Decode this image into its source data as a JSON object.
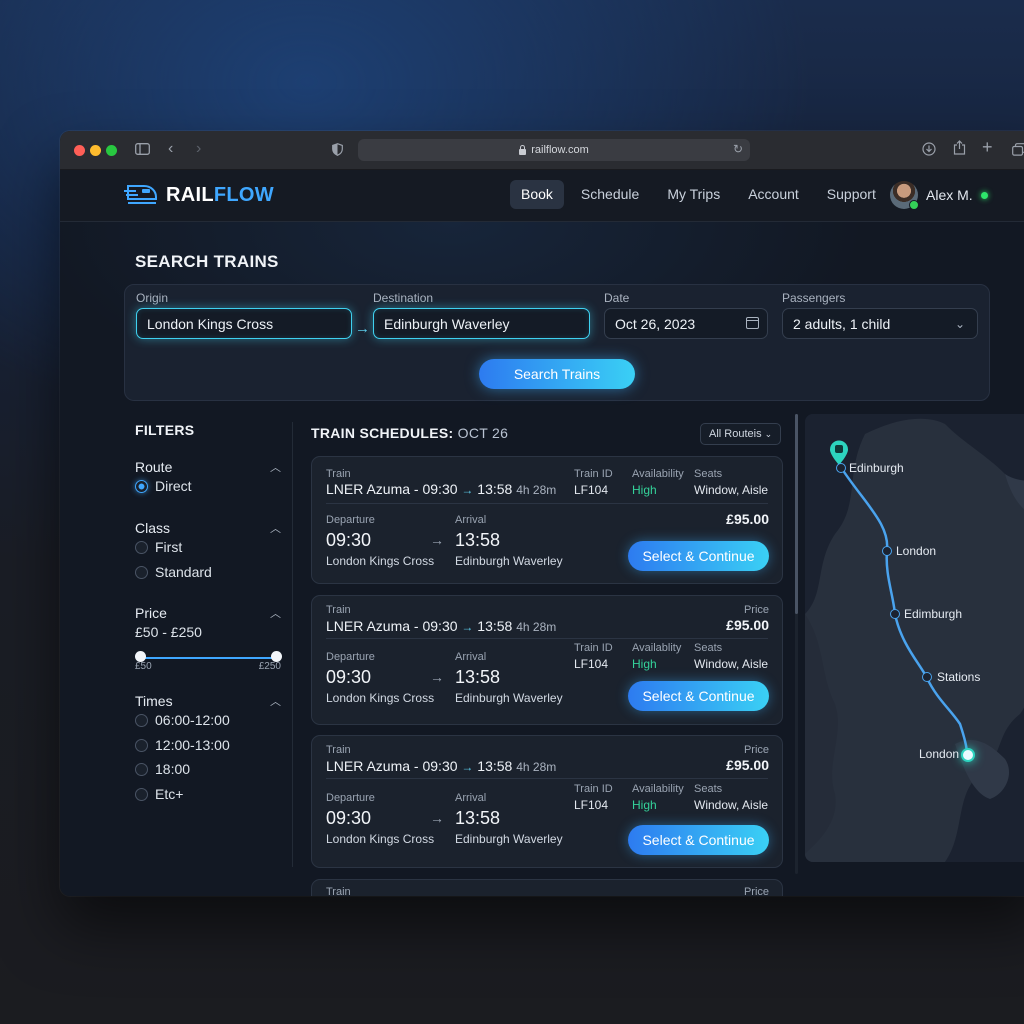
{
  "browser": {
    "url": "railflow.com",
    "traffic_lights": [
      "#ff5f57",
      "#febc2e",
      "#28c840"
    ]
  },
  "brand": {
    "name_part1": "RAIL",
    "name_part2": "FLOW",
    "accent": "#3fa7ff",
    "icon": "train-icon"
  },
  "nav": {
    "links": [
      "Book",
      "Schedule",
      "My Trips",
      "Account",
      "Support"
    ],
    "active": "Book",
    "user_name": "Alex M."
  },
  "search": {
    "title": "SEARCH TRAINS",
    "origin_label": "Origin",
    "origin_value": "London Kings Cross",
    "destination_label": "Destination",
    "destination_value": "Edinburgh Waverley",
    "date_label": "Date",
    "date_value": "Oct 26, 2023",
    "passengers_label": "Passengers",
    "passengers_value": "2 adults, 1 child",
    "button": "Search Trains"
  },
  "filters": {
    "title": "FILTERS",
    "route": {
      "title": "Route",
      "options": [
        "Direct"
      ],
      "selected": "Direct"
    },
    "class": {
      "title": "Class",
      "options": [
        "First",
        "Standard"
      ]
    },
    "price": {
      "title": "Price",
      "range_text": "£50 - £250",
      "min_label": "£50",
      "max_label": "£250"
    },
    "times": {
      "title": "Times",
      "options": [
        "06:00-12:00",
        "12:00-13:00",
        "18:00",
        "Etc+"
      ]
    }
  },
  "schedules": {
    "title": "TRAIN SCHEDULES:",
    "date": "OCT 26",
    "routes_dropdown": "All Routeis",
    "labels": {
      "train": "Train",
      "train_id": "Train ID",
      "availability_1": "Availability",
      "availability_2": "Availablity",
      "seats": "Seats",
      "departure": "Departure",
      "arrival": "Arrival",
      "price": "Price"
    },
    "cards": [
      {
        "train": "LNER Azuma - 09:30",
        "arrow": "→",
        "arrive_short": "13:58",
        "duration": "4h 28m",
        "train_id": "LF104",
        "availability": "High",
        "seats": "Window, Aisle",
        "dep_time": "09:30",
        "dep_station": "London Kings Cross",
        "arr_time": "13:58",
        "arr_station": "Edinburgh Waverley",
        "price": "£95.00",
        "button": "Select & Continue"
      },
      {
        "train": "LNER Azuma - 09:30",
        "arrow": "→",
        "arrive_short": "13:58",
        "duration": "4h 28m",
        "train_id": "LF104",
        "availability": "High",
        "seats": "Window, Aisle",
        "dep_time": "09:30",
        "dep_station": "London Kings Cross",
        "arr_time": "13:58",
        "arr_station": "Edinburgh Waverley",
        "price": "£95.00",
        "button": "Select & Continue"
      },
      {
        "train": "LNER Azuma - 09:30",
        "arrow": "→",
        "arrive_short": "13:58",
        "duration": "4h 28m",
        "train_id": "LF104",
        "availability": "High",
        "seats": "Window, Aisle",
        "dep_time": "09:30",
        "dep_station": "London Kings Cross",
        "arr_time": "13:58",
        "arr_station": "Edinburgh Waverley",
        "price": "£95.00",
        "button": "Select & Continue"
      }
    ],
    "partial_card": {
      "train": "Train",
      "price": "Price"
    }
  },
  "map": {
    "stations": [
      "Edinburgh",
      "London",
      "Edimburgh",
      "Stations",
      "London"
    ],
    "pin_icon": "location-pin-icon",
    "route_color": "#4aa3ee"
  }
}
